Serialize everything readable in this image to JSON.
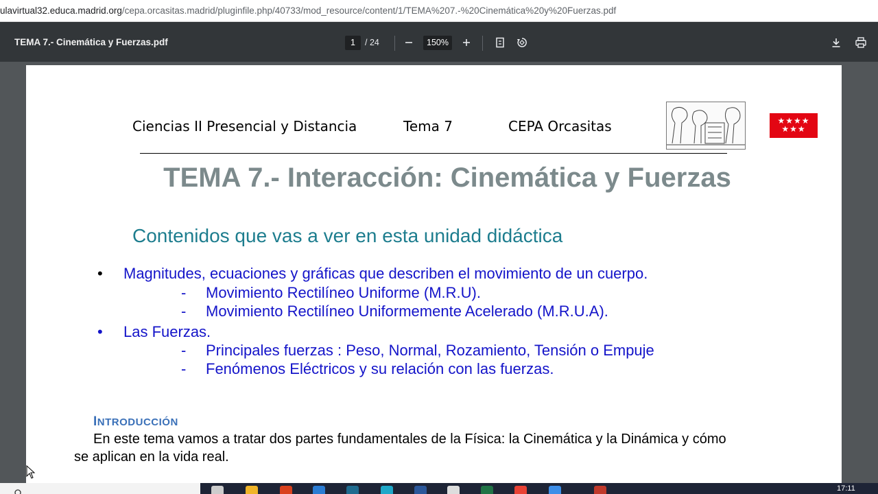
{
  "browser": {
    "url_host": "ulavirtual32.educa.madrid.org",
    "url_path": "/cepa.orcasitas.madrid/pluginfile.php/40733/mod_resource/content/1/TEMA%207.-%20Cinemática%20y%20Fuerzas.pdf"
  },
  "pdf_toolbar": {
    "doc_title": "TEMA 7.- Cinemática y Fuerzas.pdf",
    "page_current": "1",
    "page_total": "/ 24",
    "zoom": "150%",
    "icons": [
      "minus-icon",
      "plus-icon",
      "fit-page-icon",
      "rotate-icon",
      "download-icon",
      "print-icon"
    ]
  },
  "doc": {
    "header_course": "Ciencias II  Presencial y Distancia",
    "header_topic": "Tema 7",
    "header_school": "CEPA Orcasitas",
    "flag_stars": "★★★★\n★★★",
    "title": "TEMA 7.- Interacción: Cinemática y Fuerzas",
    "subtitle": "Contenidos que vas a ver en esta unidad didáctica",
    "bullets": [
      {
        "text": "Magnitudes, ecuaciones y gráficas que describen el movimiento de un cuerpo.",
        "subitems": [
          "Movimiento Rectilíneo Uniforme (M.R.U).",
          "Movimiento Rectilíneo Uniformemente Acelerado (M.R.U.A)."
        ]
      },
      {
        "text": "Las Fuerzas.",
        "subitems": [
          "Principales fuerzas : Peso, Normal, Rozamiento, Tensión o Empuje",
          "Fenómenos Eléctricos y su relación con las fuerzas."
        ]
      }
    ],
    "bullet_char": "•",
    "dash_char": "-",
    "intro_heading_initial": "I",
    "intro_heading_rest": "NTRODUCCIÓN",
    "intro_line1": "En este tema vamos a tratar dos partes fundamentales de la Física: la Cinemática y la Dinámica y cómo",
    "intro_line2": "se aplican en la vida real."
  },
  "taskbar": {
    "clock": "17:11"
  },
  "colors": {
    "title_gray": "#7c8a8c",
    "subtitle_teal": "#1d7d8e",
    "bullet_blue": "#1414c9",
    "intro_blue": "#3a70b8",
    "flag_red": "#e30613"
  }
}
